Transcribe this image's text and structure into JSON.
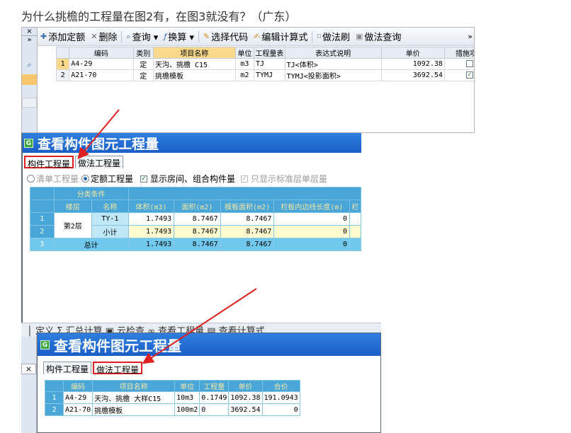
{
  "question": "为什么挑檐的工程量在图2有，在图3就没有？（广东）",
  "panel1": {
    "toolbar": [
      {
        "icon": "add-quota-icon",
        "label": "添加定额"
      },
      {
        "icon": "delete-icon",
        "label": "删除"
      },
      {
        "icon": "search-icon",
        "label": "查询 ▾"
      },
      {
        "icon": "convert-icon",
        "label": "换算 ▾"
      },
      {
        "icon": "select-code-icon",
        "label": "选择代码"
      },
      {
        "icon": "edit-formula-icon",
        "label": "编辑计算式"
      },
      {
        "icon": "method-brush-icon",
        "label": "做法刷"
      },
      {
        "icon": "method-query-icon",
        "label": "做法查询"
      }
    ],
    "overflow": "»",
    "side_close": "×",
    "side_expand": "»",
    "columns": [
      "编码",
      "类别",
      "项目名称",
      "单位",
      "工程量表",
      "表达式说明",
      "单价",
      "措施项目"
    ],
    "rows": [
      {
        "n": "1",
        "code": "A4-29",
        "type": "定",
        "name": "天沟、挑檐 C15",
        "unit": "m3",
        "qty": "TJ",
        "expr": "TJ<体积>",
        "price": "1092.38",
        "measure": "☐"
      },
      {
        "n": "2",
        "code": "A21-70",
        "type": "定",
        "name": "挑檐模板",
        "unit": "m2",
        "qty": "TYMJ",
        "expr": "TYMJ<投影面积>",
        "price": "3692.54",
        "measure": "☑"
      }
    ]
  },
  "panel2": {
    "title": "查看构件图元工程量",
    "tabs": [
      "构件工程量",
      "做法工程量"
    ],
    "options": [
      "清单工程量",
      "定额工程量",
      "显示房间、组合构件量",
      "只显示标准层单层量"
    ],
    "group_header": "分类条件",
    "columns": [
      "楼层",
      "名称",
      "体积(m3)",
      "面积(m2)",
      "模板面积(m2)",
      "栏板内边线长度(m)",
      "栏"
    ],
    "floor": "第2层",
    "rows": [
      {
        "n": "1",
        "name": "TY-1",
        "v": "1.7493",
        "a": "8.7467",
        "f": "8.7467",
        "l": "0"
      },
      {
        "n": "2",
        "name": "小计",
        "v": "1.7493",
        "a": "8.7467",
        "f": "8.7467",
        "l": "0"
      }
    ],
    "total": {
      "n": "3",
      "label": "总计",
      "v": "1.7493",
      "a": "8.7467",
      "f": "8.7467",
      "l": "0"
    }
  },
  "panel3": {
    "behind_toolbar": "│  定义   Σ 汇总计算  ▣ 云检查   ∞ 查看工程量  ▤ 查看计算式",
    "side_close": "×",
    "title": "查看构件图元工程量",
    "tabs": [
      "构件工程量",
      "做法工程量"
    ],
    "columns": [
      "编码",
      "项目名称",
      "单位",
      "工程量",
      "单价",
      "合价"
    ],
    "rows": [
      {
        "n": "1",
        "code": "A4-29",
        "name": "天沟、挑檐 大样C15",
        "unit": "10m3",
        "qty": "0.1749",
        "price": "1092.38",
        "total": "191.0943"
      },
      {
        "n": "2",
        "code": "A21-70",
        "name": "挑檐模板",
        "unit": "100m2",
        "qty": "0",
        "price": "3692.54",
        "total": "0"
      }
    ]
  },
  "colors": {
    "accent": "#1a5fc6",
    "highlight": "#e02020",
    "header_blue": "#48a6d8"
  }
}
